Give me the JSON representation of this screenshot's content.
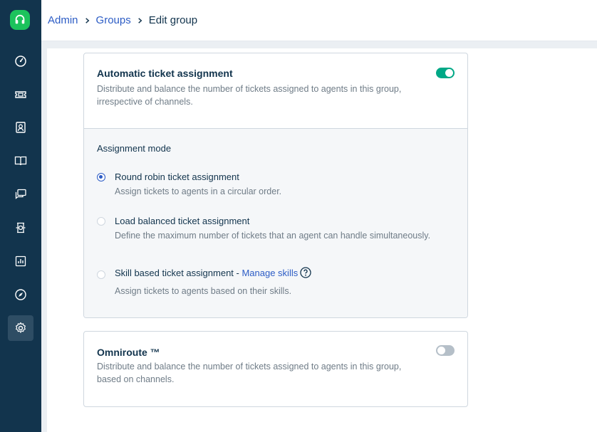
{
  "breadcrumb": {
    "root": "Admin",
    "section": "Groups",
    "current": "Edit group"
  },
  "nav": [
    {
      "icon": "dashboard-icon"
    },
    {
      "icon": "tickets-icon"
    },
    {
      "icon": "contacts-icon"
    },
    {
      "icon": "solutions-icon"
    },
    {
      "icon": "forums-icon"
    },
    {
      "icon": "assets-icon"
    },
    {
      "icon": "reports-icon"
    },
    {
      "icon": "discover-icon"
    },
    {
      "icon": "admin-gear-icon",
      "active": true
    }
  ],
  "auto_assign": {
    "title": "Automatic ticket assignment",
    "description": "Distribute and balance the number of tickets assigned to agents in this group, irrespective of channels.",
    "enabled": true,
    "mode_label": "Assignment mode",
    "options": [
      {
        "label": "Round robin ticket assignment",
        "description": "Assign tickets to agents in a circular order.",
        "selected": true
      },
      {
        "label": "Load balanced ticket assignment",
        "description": "Define the maximum number of tickets that an agent can handle simultaneously.",
        "selected": false
      },
      {
        "label": "Skill based ticket assignment - ",
        "link": "Manage skills",
        "description": "Assign tickets to agents based on their skills.",
        "selected": false
      }
    ]
  },
  "omniroute": {
    "title": "Omniroute ™",
    "description": "Distribute and balance the number of tickets assigned to agents in this group, based on channels.",
    "enabled": false
  },
  "colors": {
    "sidebar": "#12344d",
    "brand": "#1cc35c",
    "toggle_on": "#00a886",
    "link": "#2c5cc5"
  }
}
